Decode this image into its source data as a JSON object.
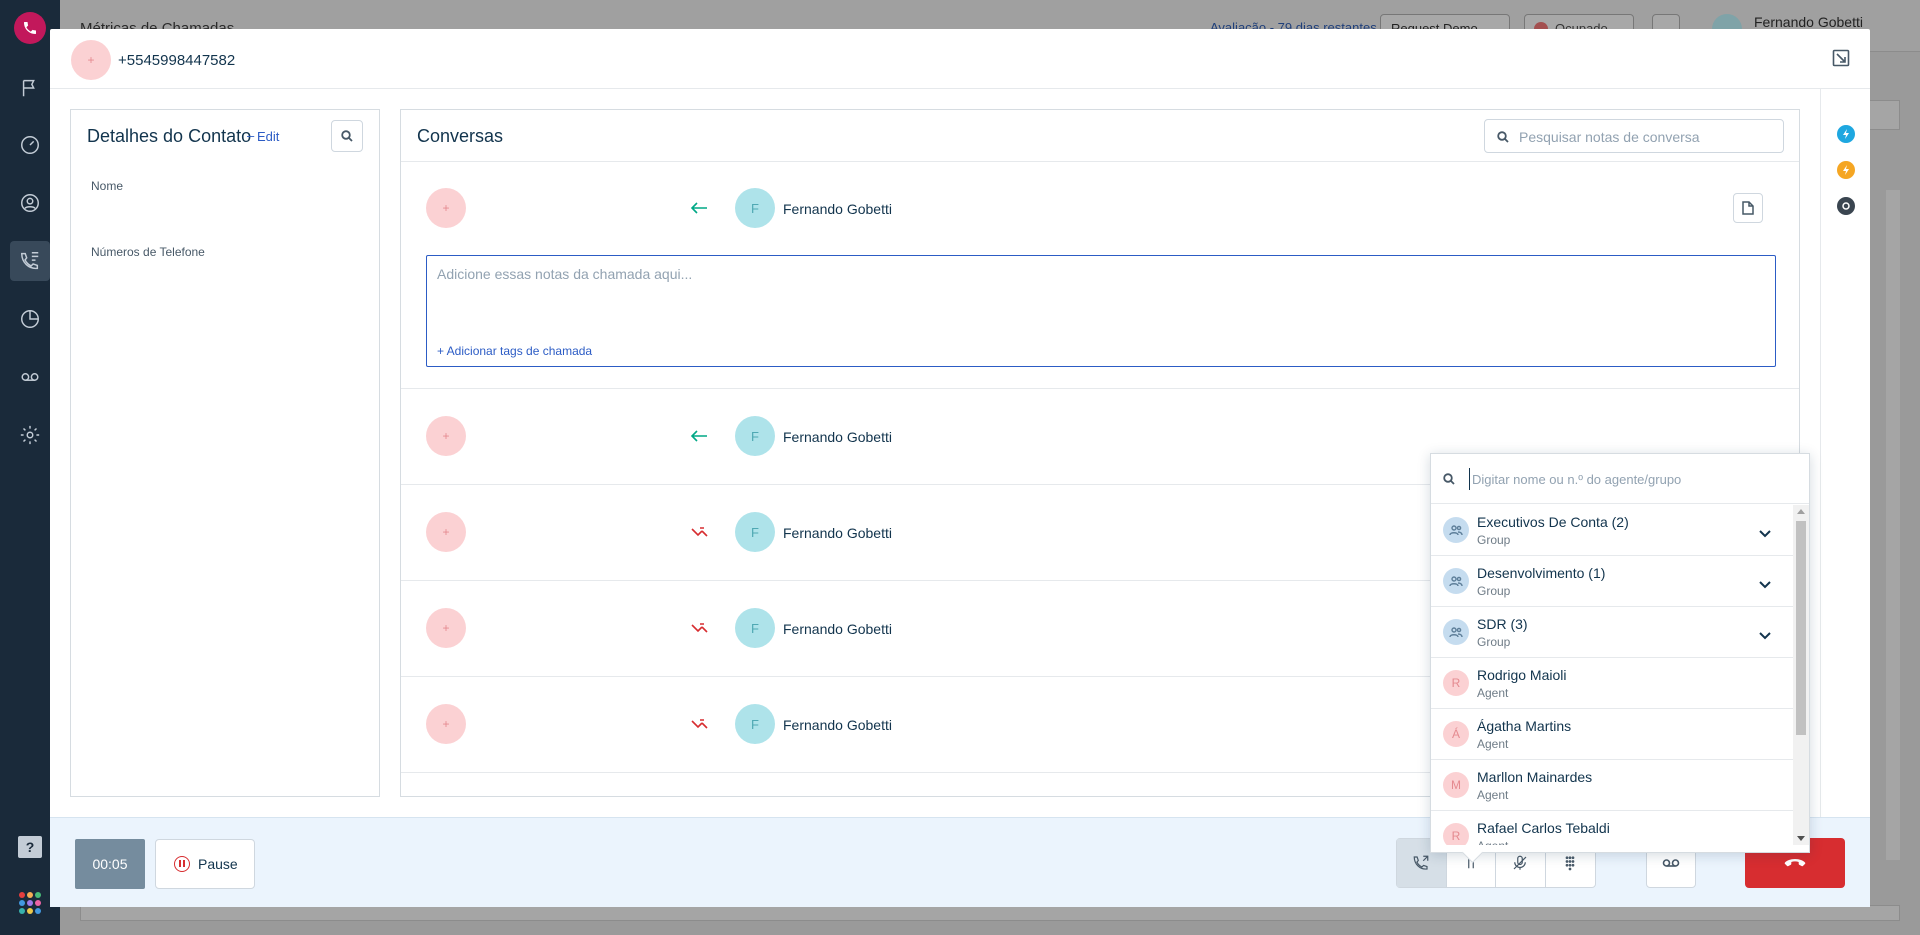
{
  "background": {
    "page_title": "Métricas de Chamadas",
    "trial_text": "Avaliação - 79 dias restantes",
    "request_demo": "Request Demo",
    "status": "Ocupado",
    "user_name": "Fernando Gobetti"
  },
  "modal": {
    "header": {
      "avatar_letter": "+",
      "phone": "+5545998447582"
    },
    "contact": {
      "title": "Detalhes do Contato",
      "edit_dash": "–",
      "edit_label": "Edit",
      "fields": [
        "Nome",
        "Números de Telefone"
      ]
    },
    "conversations": {
      "title": "Conversas",
      "search_placeholder": "Pesquisar notas de conversa",
      "notes_placeholder": "Adicione essas notas da chamada aqui...",
      "add_tags": "+ Adicionar tags de chamada",
      "rows": [
        {
          "avatar": "+",
          "direction": "incoming",
          "agent_letter": "F",
          "agent": "Fernando Gobetti"
        },
        {
          "avatar": "+",
          "direction": "incoming",
          "agent_letter": "F",
          "agent": "Fernando Gobetti"
        },
        {
          "avatar": "+",
          "direction": "missed",
          "agent_letter": "F",
          "agent": "Fernando Gobetti"
        },
        {
          "avatar": "+",
          "direction": "missed",
          "agent_letter": "F",
          "agent": "Fernando Gobetti"
        },
        {
          "avatar": "+",
          "direction": "missed",
          "agent_letter": "F",
          "agent": "Fernando Gobetti"
        }
      ]
    },
    "transfer": {
      "search_placeholder": "Digitar nome ou n.º do agente/grupo",
      "items": [
        {
          "name": "Executivos De Conta (2)",
          "type": "Group",
          "kind": "group"
        },
        {
          "name": "Desenvolvimento (1)",
          "type": "Group",
          "kind": "group"
        },
        {
          "name": "SDR (3)",
          "type": "Group",
          "kind": "group"
        },
        {
          "name": "Rodrigo Maioli",
          "type": "Agent",
          "kind": "agent",
          "letter": "R"
        },
        {
          "name": "Ágatha Martins",
          "type": "Agent",
          "kind": "agent",
          "letter": "Á"
        },
        {
          "name": "Marllon Mainardes",
          "type": "Agent",
          "kind": "agent",
          "letter": "M"
        },
        {
          "name": "Rafael Carlos Tebaldi",
          "type": "Agent",
          "kind": "agent",
          "letter": "R"
        }
      ]
    },
    "call_bar": {
      "timer": "00:05",
      "pause_label": "Pause"
    }
  },
  "icons": {
    "rail": [
      "phone-logo-icon",
      "flag-icon",
      "dashboard-icon",
      "contact-icon",
      "call-log-icon",
      "reports-icon",
      "voicemail-icon",
      "settings-icon",
      "help-icon",
      "apps-grid-icon"
    ],
    "right_rail": [
      "freshdesk-bolt-icon",
      "bolt-icon",
      "target-icon"
    ],
    "call_controls": [
      "transfer-call-icon",
      "hold-icon",
      "mute-icon",
      "keypad-icon",
      "voicemail-drop-icon",
      "hangup-icon"
    ]
  },
  "colors": {
    "accent_blue": "#2c5cc5",
    "hangup_red": "#d72d30",
    "incoming_green": "#00a886",
    "missed_red": "#d72d30",
    "rail_bg": "#1a2a3a",
    "call_bar_bg": "#ebf4fd"
  }
}
